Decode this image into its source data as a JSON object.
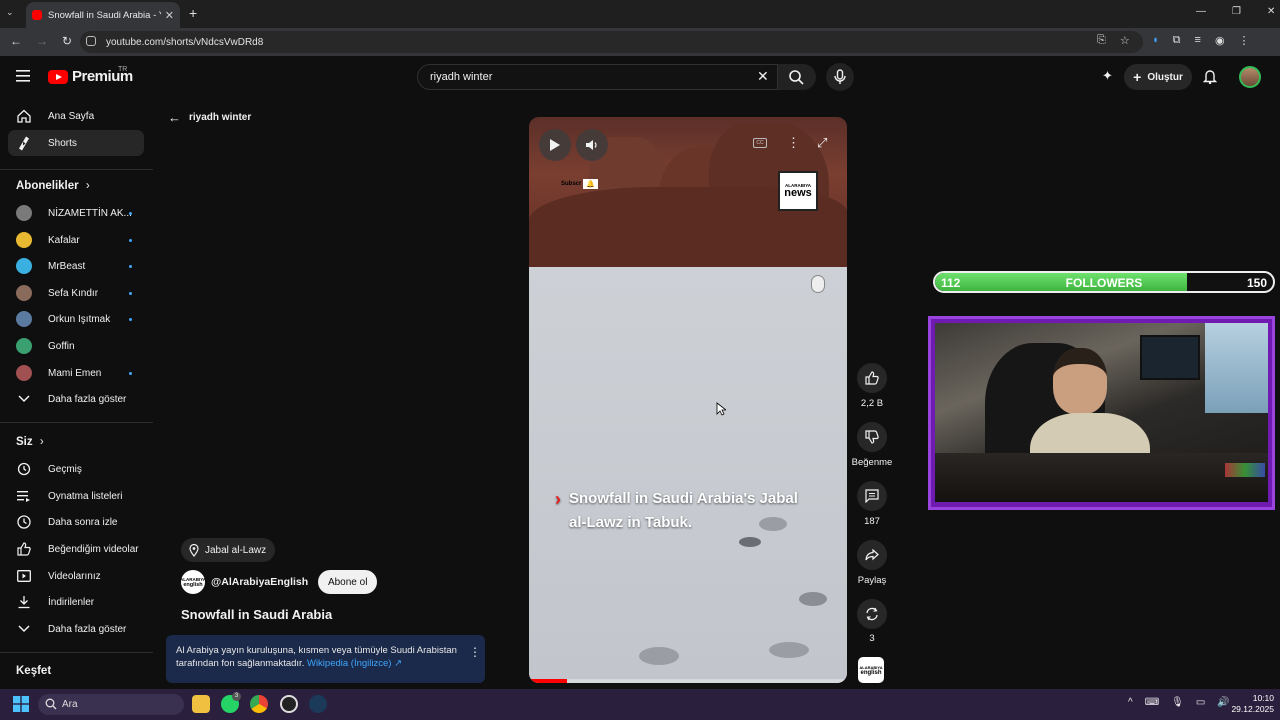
{
  "browser": {
    "tab_title": "Snowfall in Saudi Arabia - Y",
    "url": "youtube.com/shorts/vNdcsVwDRd8"
  },
  "header": {
    "brand": "Premium",
    "country": "TR",
    "search_value": "riyadh winter",
    "create_label": "Oluştur"
  },
  "sidebar": {
    "home": "Ana Sayfa",
    "shorts": "Shorts",
    "subscriptions_title": "Abonelikler",
    "channels": [
      {
        "name": "NİZAMETTİN AK...",
        "color": "#7a7a7a"
      },
      {
        "name": "Kafalar",
        "color": "#e8b830"
      },
      {
        "name": "MrBeast",
        "color": "#3ab0e0"
      },
      {
        "name": "Sefa Kındır",
        "color": "#8a6a5a"
      },
      {
        "name": "Orkun Işıtmak",
        "color": "#5a7aa0"
      },
      {
        "name": "Goffin",
        "color": "#3aa070"
      },
      {
        "name": "Mami Emen",
        "color": "#a05050"
      }
    ],
    "show_more_1": "Daha fazla göster",
    "you_title": "Siz",
    "you_items": [
      "Geçmiş",
      "Oynatma listeleri",
      "Daha sonra izle",
      "Beğendiğim videolar",
      "Videolarınız",
      "İndirilenler"
    ],
    "show_more_2": "Daha fazla göster",
    "explore_title": "Keşfet"
  },
  "shorts": {
    "back_label": "riyadh winter",
    "video_caption": "Snowfall in Saudi Arabia's Jabal al-Lawz in Tabuk.",
    "news_logo_top": "ALARABIYA",
    "news_logo_main": "news",
    "subscribe_overlay": "Subscr",
    "like_count": "2,2 B",
    "dislike_label": "Beğenme",
    "comment_count": "187",
    "share_label": "Paylaş",
    "remix_count": "3",
    "channel_thumb_line1": "ALARABIYA",
    "channel_thumb_line2": "english",
    "location": "Jabal al-Lawz",
    "channel_handle": "@AlArabiyaEnglish",
    "subscribe_label": "Abone ol",
    "title": "Snowfall in Saudi Arabia",
    "info_text": "Al Arabiya yayın kuruluşuna, kısmen veya tümüyle Suudi Arabistan tarafından fon sağlanmaktadır.",
    "info_link": "Wikipedia (İngilizce) ↗",
    "progress_fraction": 0.12
  },
  "overlay": {
    "followers_current": "112",
    "followers_label": "FOLLOWERS",
    "followers_goal": "150",
    "followers_fraction": 0.747
  },
  "taskbar": {
    "search_label": "Ara",
    "time": "10:10",
    "date": "29.12.2025",
    "whatsapp_badge": "3"
  }
}
